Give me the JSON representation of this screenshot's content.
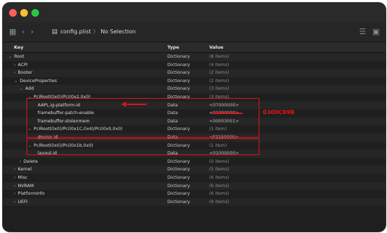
{
  "toolbar": {
    "file_name": "config.plist",
    "selection": "No Selection"
  },
  "columns": {
    "key": "Key",
    "type": "Type",
    "value": "Value"
  },
  "rows": [
    {
      "key": "Root",
      "type": "Dictionary",
      "value": "(8 items)",
      "indent": 0,
      "chevron": "v",
      "dim": true
    },
    {
      "key": "ACPI",
      "type": "Dictionary",
      "value": "(4 items)",
      "indent": 1,
      "chevron": ">",
      "dim": true
    },
    {
      "key": "Booter",
      "type": "Dictionary",
      "value": "(2 items)",
      "indent": 1,
      "chevron": ">",
      "dim": true
    },
    {
      "key": "DeviceProperties",
      "type": "Dictionary",
      "value": "(2 items)",
      "indent": 1,
      "chevron": "v",
      "dim": true
    },
    {
      "key": "Add",
      "type": "Dictionary",
      "value": "(3 items)",
      "indent": 2,
      "chevron": "v",
      "dim": true
    },
    {
      "key": "PciRoot(0x0)/Pci(0x2,0x0)",
      "type": "Dictionary",
      "value": "(3 items)",
      "indent": 3,
      "chevron": "v",
      "dim": true
    },
    {
      "key": "AAPL,ig-platform-id",
      "type": "Data",
      "value": "<07000000>",
      "indent": 4,
      "chevron": "",
      "dim": false
    },
    {
      "key": "framebuffer-patch-enable",
      "type": "Data",
      "value": "<01000000>",
      "indent": 4,
      "chevron": "",
      "dim": false
    },
    {
      "key": "framebuffer-stolenmem",
      "type": "Data",
      "value": "<00003001>",
      "indent": 4,
      "chevron": "",
      "dim": false
    },
    {
      "key": "PciRoot(0x0)/Pci(0x1C,0x4)/Pci(0x0,0x0)",
      "type": "Dictionary",
      "value": "(1 item)",
      "indent": 3,
      "chevron": "v",
      "dim": true
    },
    {
      "key": "device-id",
      "type": "Data",
      "value": "<F2150000>",
      "indent": 4,
      "chevron": "",
      "dim": false
    },
    {
      "key": "PciRoot(0x0)/Pci(0x1b,0x0)",
      "type": "Dictionary",
      "value": "(1 item)",
      "indent": 3,
      "chevron": "v",
      "dim": true
    },
    {
      "key": "layout-id",
      "type": "Data",
      "value": "<01000000>",
      "indent": 4,
      "chevron": "",
      "dim": false
    },
    {
      "key": "Delete",
      "type": "Dictionary",
      "value": "(0 items)",
      "indent": 2,
      "chevron": ">",
      "dim": true
    },
    {
      "key": "Kernel",
      "type": "Dictionary",
      "value": "(5 items)",
      "indent": 1,
      "chevron": ">",
      "dim": true
    },
    {
      "key": "Misc",
      "type": "Dictionary",
      "value": "(6 items)",
      "indent": 1,
      "chevron": ">",
      "dim": true
    },
    {
      "key": "NVRAM",
      "type": "Dictionary",
      "value": "(6 items)",
      "indent": 1,
      "chevron": ">",
      "dim": true
    },
    {
      "key": "PlatformInfo",
      "type": "Dictionary",
      "value": "(6 items)",
      "indent": 1,
      "chevron": ">",
      "dim": true
    },
    {
      "key": "UEFI",
      "type": "Dictionary",
      "value": "(9 items)",
      "indent": 1,
      "chevron": ">",
      "dim": true
    }
  ],
  "annotation": {
    "replacement_value": "0300C89B",
    "color": "#e0141d"
  }
}
